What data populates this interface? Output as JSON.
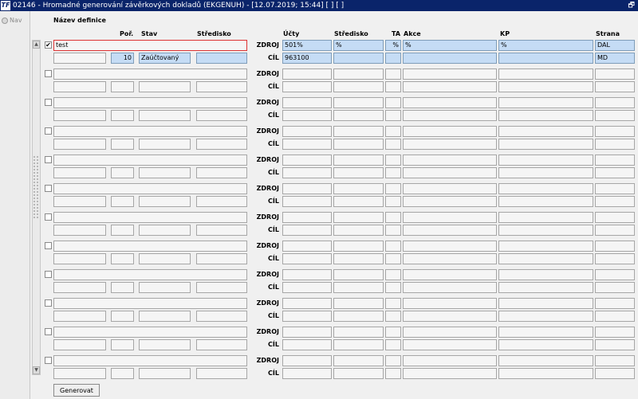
{
  "window": {
    "title": "02146 - Hromadné generování závěrkových dokladů (EKGENUH) - [12.07.2019; 15:44]  [ ]  [ ]",
    "logo_text": "TF",
    "restore_glyph": "🗗"
  },
  "nav": {
    "label": "Nav"
  },
  "headers": {
    "nazev_definice": "Název definice",
    "por": "Poř.",
    "stav": "Stav",
    "stredisko_left": "Středisko",
    "ucty": "Účty",
    "stredisko_right": "Středisko",
    "ta": "TA",
    "akce": "Akce",
    "kp": "KP",
    "strana": "Strana"
  },
  "row_labels": {
    "zdroj": "ZDROJ",
    "cil": "CÍL"
  },
  "records": [
    {
      "checked": true,
      "name": "test",
      "por": "10",
      "stav": "Zaúčtovaný",
      "stredisko_left": "",
      "zdroj": {
        "ucty": "501%",
        "stredisko": "%",
        "ta": "%",
        "akce": "%",
        "kp": "%",
        "strana": "DAL"
      },
      "cil": {
        "ucty": "963100",
        "stredisko": "",
        "ta": "",
        "akce": "",
        "kp": "",
        "strana": "MD"
      }
    },
    {
      "checked": false,
      "name": "",
      "por": "",
      "stav": "",
      "stredisko_left": "",
      "zdroj": {
        "ucty": "",
        "stredisko": "",
        "ta": "",
        "akce": "",
        "kp": "",
        "strana": ""
      },
      "cil": {
        "ucty": "",
        "stredisko": "",
        "ta": "",
        "akce": "",
        "kp": "",
        "strana": ""
      }
    },
    {
      "checked": false,
      "name": "",
      "por": "",
      "stav": "",
      "stredisko_left": "",
      "zdroj": {
        "ucty": "",
        "stredisko": "",
        "ta": "",
        "akce": "",
        "kp": "",
        "strana": ""
      },
      "cil": {
        "ucty": "",
        "stredisko": "",
        "ta": "",
        "akce": "",
        "kp": "",
        "strana": ""
      }
    },
    {
      "checked": false,
      "name": "",
      "por": "",
      "stav": "",
      "stredisko_left": "",
      "zdroj": {
        "ucty": "",
        "stredisko": "",
        "ta": "",
        "akce": "",
        "kp": "",
        "strana": ""
      },
      "cil": {
        "ucty": "",
        "stredisko": "",
        "ta": "",
        "akce": "",
        "kp": "",
        "strana": ""
      }
    },
    {
      "checked": false,
      "name": "",
      "por": "",
      "stav": "",
      "stredisko_left": "",
      "zdroj": {
        "ucty": "",
        "stredisko": "",
        "ta": "",
        "akce": "",
        "kp": "",
        "strana": ""
      },
      "cil": {
        "ucty": "",
        "stredisko": "",
        "ta": "",
        "akce": "",
        "kp": "",
        "strana": ""
      }
    },
    {
      "checked": false,
      "name": "",
      "por": "",
      "stav": "",
      "stredisko_left": "",
      "zdroj": {
        "ucty": "",
        "stredisko": "",
        "ta": "",
        "akce": "",
        "kp": "",
        "strana": ""
      },
      "cil": {
        "ucty": "",
        "stredisko": "",
        "ta": "",
        "akce": "",
        "kp": "",
        "strana": ""
      }
    },
    {
      "checked": false,
      "name": "",
      "por": "",
      "stav": "",
      "stredisko_left": "",
      "zdroj": {
        "ucty": "",
        "stredisko": "",
        "ta": "",
        "akce": "",
        "kp": "",
        "strana": ""
      },
      "cil": {
        "ucty": "",
        "stredisko": "",
        "ta": "",
        "akce": "",
        "kp": "",
        "strana": ""
      }
    },
    {
      "checked": false,
      "name": "",
      "por": "",
      "stav": "",
      "stredisko_left": "",
      "zdroj": {
        "ucty": "",
        "stredisko": "",
        "ta": "",
        "akce": "",
        "kp": "",
        "strana": ""
      },
      "cil": {
        "ucty": "",
        "stredisko": "",
        "ta": "",
        "akce": "",
        "kp": "",
        "strana": ""
      }
    },
    {
      "checked": false,
      "name": "",
      "por": "",
      "stav": "",
      "stredisko_left": "",
      "zdroj": {
        "ucty": "",
        "stredisko": "",
        "ta": "",
        "akce": "",
        "kp": "",
        "strana": ""
      },
      "cil": {
        "ucty": "",
        "stredisko": "",
        "ta": "",
        "akce": "",
        "kp": "",
        "strana": ""
      }
    },
    {
      "checked": false,
      "name": "",
      "por": "",
      "stav": "",
      "stredisko_left": "",
      "zdroj": {
        "ucty": "",
        "stredisko": "",
        "ta": "",
        "akce": "",
        "kp": "",
        "strana": ""
      },
      "cil": {
        "ucty": "",
        "stredisko": "",
        "ta": "",
        "akce": "",
        "kp": "",
        "strana": ""
      }
    },
    {
      "checked": false,
      "name": "",
      "por": "",
      "stav": "",
      "stredisko_left": "",
      "zdroj": {
        "ucty": "",
        "stredisko": "",
        "ta": "",
        "akce": "",
        "kp": "",
        "strana": ""
      },
      "cil": {
        "ucty": "",
        "stredisko": "",
        "ta": "",
        "akce": "",
        "kp": "",
        "strana": ""
      }
    },
    {
      "checked": false,
      "name": "",
      "por": "",
      "stav": "",
      "stredisko_left": "",
      "zdroj": {
        "ucty": "",
        "stredisko": "",
        "ta": "",
        "akce": "",
        "kp": "",
        "strana": ""
      },
      "cil": {
        "ucty": "",
        "stredisko": "",
        "ta": "",
        "akce": "",
        "kp": "",
        "strana": ""
      }
    }
  ],
  "buttons": {
    "generovat": "Generovat"
  },
  "scrollbar": {
    "up_glyph": "▲",
    "down_glyph": "▼"
  },
  "checkbox_glyph": "✔",
  "colors": {
    "titlebar": "#0a246a",
    "active_field": "#c5dcf5",
    "focus_border": "#dd3333"
  }
}
